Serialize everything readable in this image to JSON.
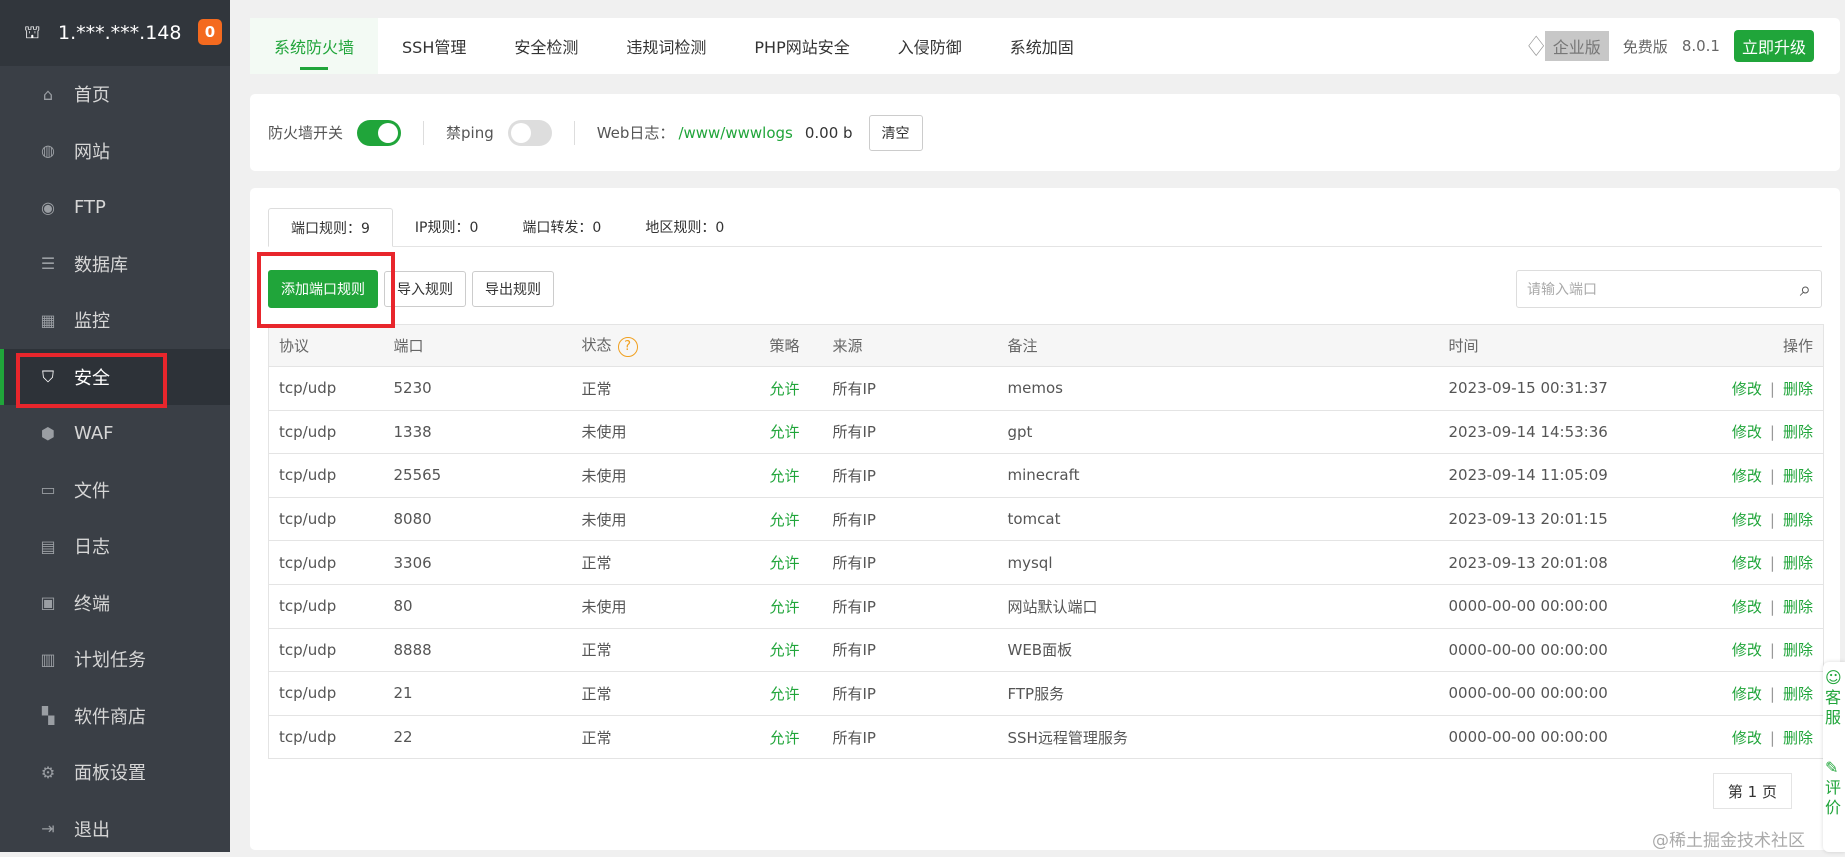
{
  "server": {
    "ip": "1.***.***.148",
    "badge": "0"
  },
  "sidebar": {
    "items": [
      {
        "label": "首页",
        "icon": "home-icon",
        "glyph": "⌂"
      },
      {
        "label": "网站",
        "icon": "globe-icon",
        "glyph": "◍"
      },
      {
        "label": "FTP",
        "icon": "ftp-icon",
        "glyph": "◉"
      },
      {
        "label": "数据库",
        "icon": "database-icon",
        "glyph": "☰"
      },
      {
        "label": "监控",
        "icon": "monitor-icon",
        "glyph": "▦"
      },
      {
        "label": "安全",
        "icon": "shield-icon",
        "glyph": "⛉"
      },
      {
        "label": "WAF",
        "icon": "waf-icon",
        "glyph": "⬢"
      },
      {
        "label": "文件",
        "icon": "folder-icon",
        "glyph": "▭"
      },
      {
        "label": "日志",
        "icon": "log-icon",
        "glyph": "▤"
      },
      {
        "label": "终端",
        "icon": "terminal-icon",
        "glyph": "▣"
      },
      {
        "label": "计划任务",
        "icon": "calendar-icon",
        "glyph": "▥"
      },
      {
        "label": "软件商店",
        "icon": "apps-icon",
        "glyph": "▚"
      },
      {
        "label": "面板设置",
        "icon": "gear-icon",
        "glyph": "⚙"
      },
      {
        "label": "退出",
        "icon": "logout-icon",
        "glyph": "⇥"
      }
    ]
  },
  "topnav": {
    "tabs": [
      "系统防火墙",
      "SSH管理",
      "安全检测",
      "违规词检测",
      "PHP网站安全",
      "入侵防御",
      "系统加固"
    ],
    "enterprise": "企业版",
    "free": "免费版",
    "version": "8.0.1",
    "upgrade": "立即升级"
  },
  "settings": {
    "firewall_label": "防火墙开关",
    "firewall_on": true,
    "ping_label": "禁ping",
    "ping_on": false,
    "weblog_label": "Web日志：",
    "weblog_path": "/www/wwwlogs",
    "weblog_size": "0.00 b",
    "clear": "清空"
  },
  "subtabs": [
    "端口规则：9",
    "IP规则：0",
    "端口转发：0",
    "地区规则：0"
  ],
  "toolbar": {
    "add": "添加端口规则",
    "import": "导入规则",
    "export": "导出规则",
    "search_placeholder": "请输入端口"
  },
  "table": {
    "headers": [
      "协议",
      "端口",
      "状态",
      "策略",
      "来源",
      "备注",
      "时间",
      "操作"
    ],
    "rows": [
      [
        "tcp/udp",
        "5230",
        "正常",
        "允许",
        "所有IP",
        "memos",
        "2023-09-15 00:31:37"
      ],
      [
        "tcp/udp",
        "1338",
        "未使用",
        "允许",
        "所有IP",
        "gpt",
        "2023-09-14 14:53:36"
      ],
      [
        "tcp/udp",
        "25565",
        "未使用",
        "允许",
        "所有IP",
        "minecraft",
        "2023-09-14 11:05:09"
      ],
      [
        "tcp/udp",
        "8080",
        "未使用",
        "允许",
        "所有IP",
        "tomcat",
        "2023-09-13 20:01:15"
      ],
      [
        "tcp/udp",
        "3306",
        "正常",
        "允许",
        "所有IP",
        "mysql",
        "2023-09-13 20:01:08"
      ],
      [
        "tcp/udp",
        "80",
        "未使用",
        "允许",
        "所有IP",
        "网站默认端口",
        "0000-00-00 00:00:00"
      ],
      [
        "tcp/udp",
        "8888",
        "正常",
        "允许",
        "所有IP",
        "WEB面板",
        "0000-00-00 00:00:00"
      ],
      [
        "tcp/udp",
        "21",
        "正常",
        "允许",
        "所有IP",
        "FTP服务",
        "0000-00-00 00:00:00"
      ],
      [
        "tcp/udp",
        "22",
        "正常",
        "允许",
        "所有IP",
        "SSH远程管理服务",
        "0000-00-00 00:00:00"
      ]
    ],
    "edit": "修改",
    "delete": "删除"
  },
  "pager": "第 1 页",
  "float": {
    "service": "客服",
    "review": "评价"
  },
  "watermark": "@稀土掘金技术社区"
}
